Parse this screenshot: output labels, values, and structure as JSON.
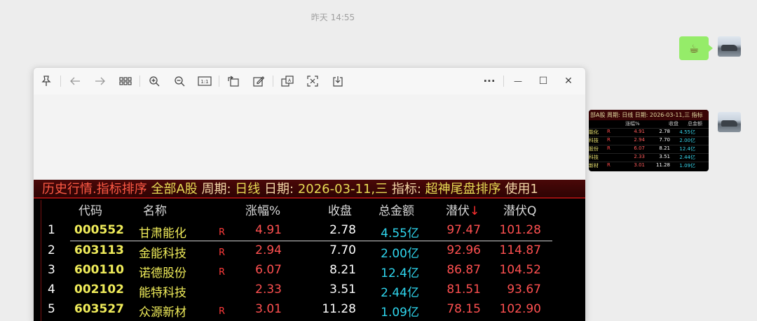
{
  "chat": {
    "timestamp": "昨天 14:55",
    "message_emoji": "☕"
  },
  "thumbnail": {
    "title": "部A股 周期: 日线 日期: 2026-03-11,三 指标",
    "headers": [
      "涨幅%",
      "收盘",
      "总金额"
    ],
    "rows": [
      {
        "name": "能化",
        "flag": "R",
        "chg": "4.91",
        "close": "2.78",
        "amt": "4.55亿"
      },
      {
        "name": "科技",
        "flag": "R",
        "chg": "2.94",
        "close": "7.70",
        "amt": "2.00亿"
      },
      {
        "name": "股份",
        "flag": "R",
        "chg": "6.07",
        "close": "8.21",
        "amt": "12.4亿"
      },
      {
        "name": "科技",
        "flag": "",
        "chg": "2.33",
        "close": "3.51",
        "amt": "2.44亿"
      },
      {
        "name": "新材",
        "flag": "R",
        "chg": "3.01",
        "close": "11.28",
        "amt": "1.09亿"
      }
    ]
  },
  "viewer": {
    "toolbar": {
      "pin": "pin-icon",
      "back": "arrow-left-icon",
      "forward": "arrow-right-icon",
      "grid": "grid-icon",
      "zoom_in": "zoom-in-icon",
      "zoom_out": "zoom-out-icon",
      "actual_size": "1:1",
      "rotate": "rotate-icon",
      "edit": "edit-icon",
      "translate": "translate-icon",
      "ocr": "scan-icon",
      "save": "download-icon",
      "more": "···",
      "minimize": "—",
      "maximize": "☐",
      "close": "✕"
    },
    "stock_table": {
      "title_parts": {
        "a": "历史行情.指标排序",
        "b": " 全部A股",
        "c": " 周期: ",
        "d": "日线",
        "e": " 日期: ",
        "f": "2026-03-11,三",
        "g": " 指标: ",
        "h": "超神尾盘排序",
        "i": " 使用1"
      },
      "headers": {
        "code": "代码",
        "name": "名称",
        "chg": "涨幅%",
        "close": "收盘",
        "amount": "总金额",
        "q1": "潜伏",
        "q1_arrow": "↓",
        "q2": "潜伏Q"
      },
      "rows": [
        {
          "idx": "1",
          "code": "000552",
          "name": "甘肃能化",
          "flag": "R",
          "chg": "4.91",
          "close": "2.78",
          "amount": "4.55亿",
          "q1": "97.47",
          "q2": "101.28"
        },
        {
          "idx": "2",
          "code": "603113",
          "name": "金能科技",
          "flag": "R",
          "chg": "2.94",
          "close": "7.70",
          "amount": "2.00亿",
          "q1": "92.96",
          "q2": "114.87"
        },
        {
          "idx": "3",
          "code": "600110",
          "name": "诺德股份",
          "flag": "R",
          "chg": "6.07",
          "close": "8.21",
          "amount": "12.4亿",
          "q1": "86.87",
          "q2": "104.52"
        },
        {
          "idx": "4",
          "code": "002102",
          "name": "能特科技",
          "flag": "",
          "chg": "2.33",
          "close": "3.51",
          "amount": "2.44亿",
          "q1": "81.51",
          "q2": "93.67"
        },
        {
          "idx": "5",
          "code": "603527",
          "name": "众源新材",
          "flag": "R",
          "chg": "3.01",
          "close": "11.28",
          "amount": "1.09亿",
          "q1": "78.15",
          "q2": "102.90"
        }
      ]
    }
  }
}
